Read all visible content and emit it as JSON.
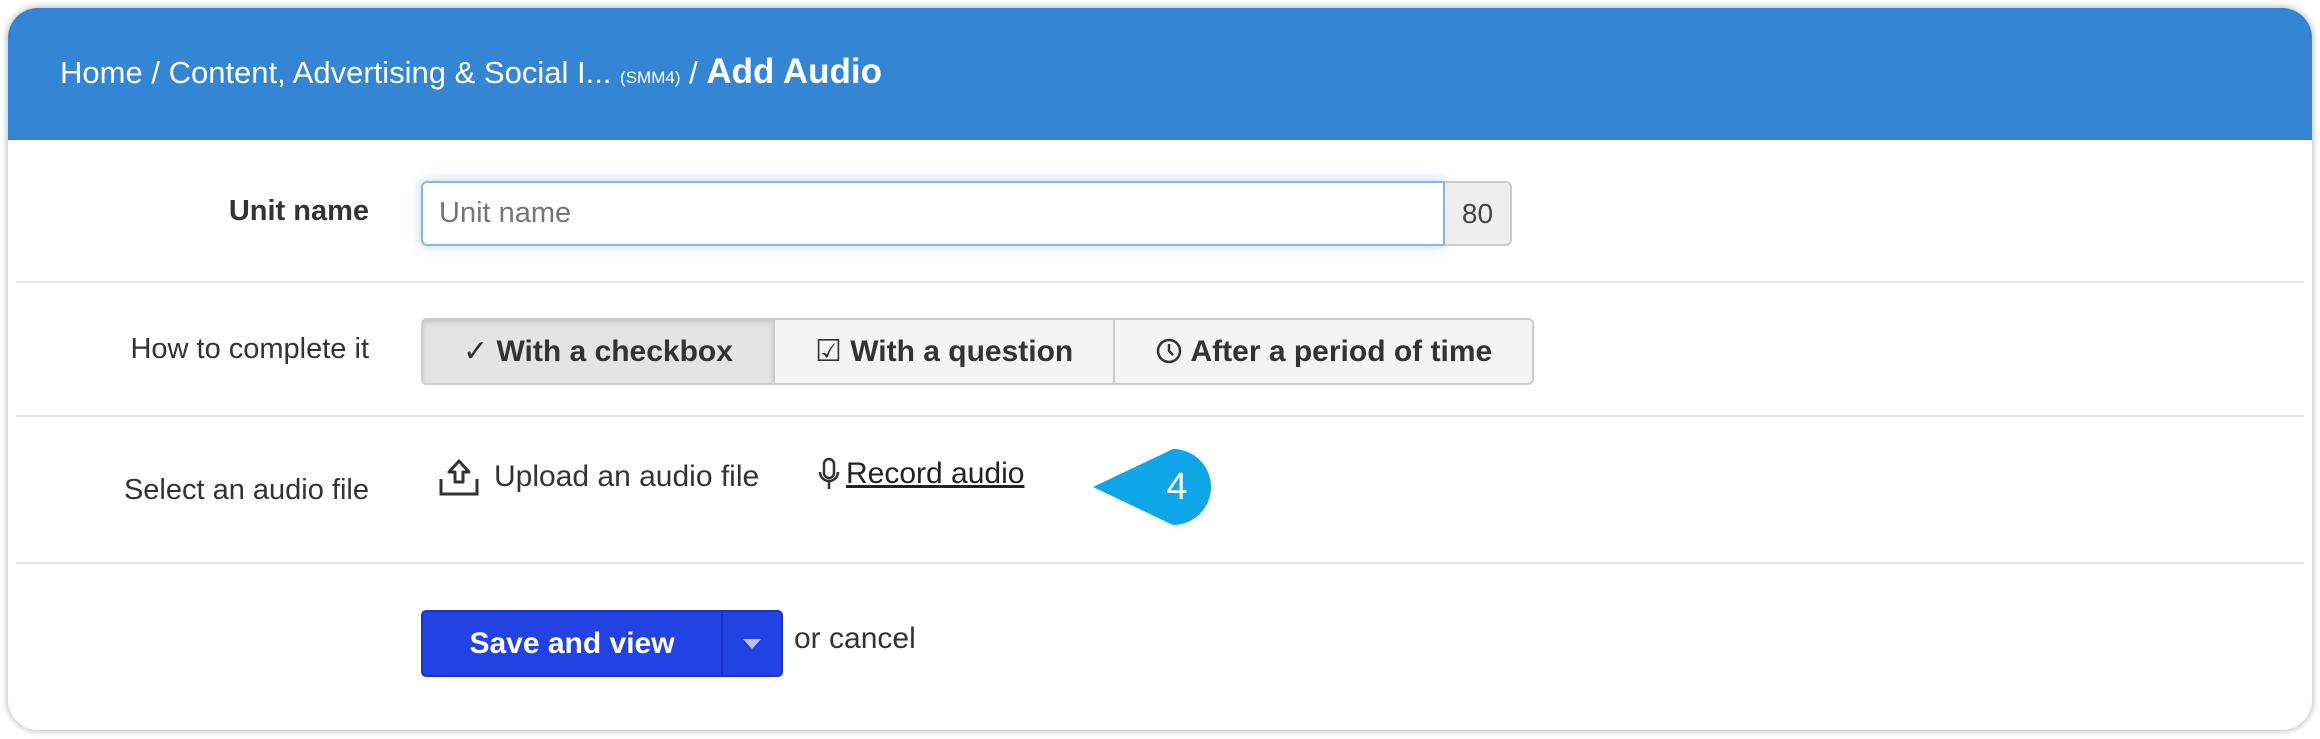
{
  "header": {
    "crumb_home": "Home",
    "crumb_course": "Content, Advertising & Social I...",
    "crumb_code": "(SMM4)",
    "current": "Add Audio",
    "separator": "/"
  },
  "unit_name": {
    "label": "Unit name",
    "placeholder": "Unit name",
    "value": "",
    "counter": "80"
  },
  "completion": {
    "label": "How to complete it",
    "options": [
      {
        "label": "With a checkbox",
        "icon": "check-icon",
        "active": true
      },
      {
        "label": "With a question",
        "icon": "checkbox-icon",
        "active": false
      },
      {
        "label": "After a period of time",
        "icon": "clock-icon",
        "active": false
      }
    ]
  },
  "audio": {
    "label": "Select an audio file",
    "upload_label": "Upload an audio file",
    "record_label": "Record audio",
    "step_badge": "4"
  },
  "colors": {
    "header": "#3585d5",
    "primary_button": "#2242e3",
    "badge": "#0ea5e9"
  },
  "actions": {
    "save_label": "Save and view",
    "cancel_label": "or cancel"
  }
}
